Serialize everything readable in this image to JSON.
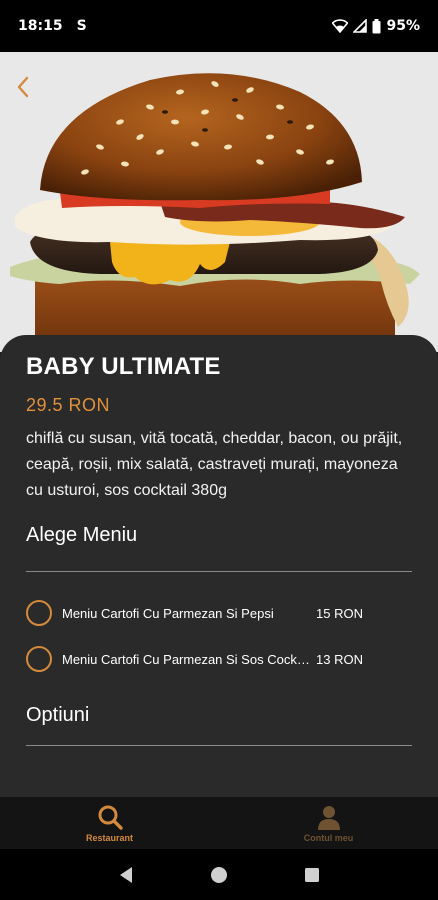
{
  "status_bar": {
    "time": "18:15",
    "notification_glyph": "S",
    "battery": "95%"
  },
  "colors": {
    "accent": "#e0923a",
    "sheet_bg": "#2a2a2a",
    "tab_active": "#d48a3c"
  },
  "product": {
    "name": "BABY ULTIMATE",
    "price": "29.5 RON",
    "description": "chiflă cu susan, vită tocată, cheddar, bacon, ou prăjit, ceapă, roșii, mix salată, castraveți murați, mayoneza cu usturoi, sos cocktail 380g"
  },
  "menu_section": {
    "title": "Alege Meniu",
    "options": [
      {
        "label": "Meniu Cartofi Cu Parmezan Si Pepsi",
        "price": "15 RON"
      },
      {
        "label": "Meniu Cartofi Cu Parmezan Si Sos Cocktail",
        "price": "13 RON"
      }
    ]
  },
  "options_section": {
    "title": "Optiuni"
  },
  "tabbar": {
    "tabs": [
      {
        "label": "Restaurant",
        "icon": "search-icon",
        "active": true
      },
      {
        "label": "Contul meu",
        "icon": "person-icon",
        "active": false
      }
    ]
  },
  "navbar": {
    "buttons": [
      "back-icon",
      "home-icon",
      "recents-icon"
    ]
  }
}
